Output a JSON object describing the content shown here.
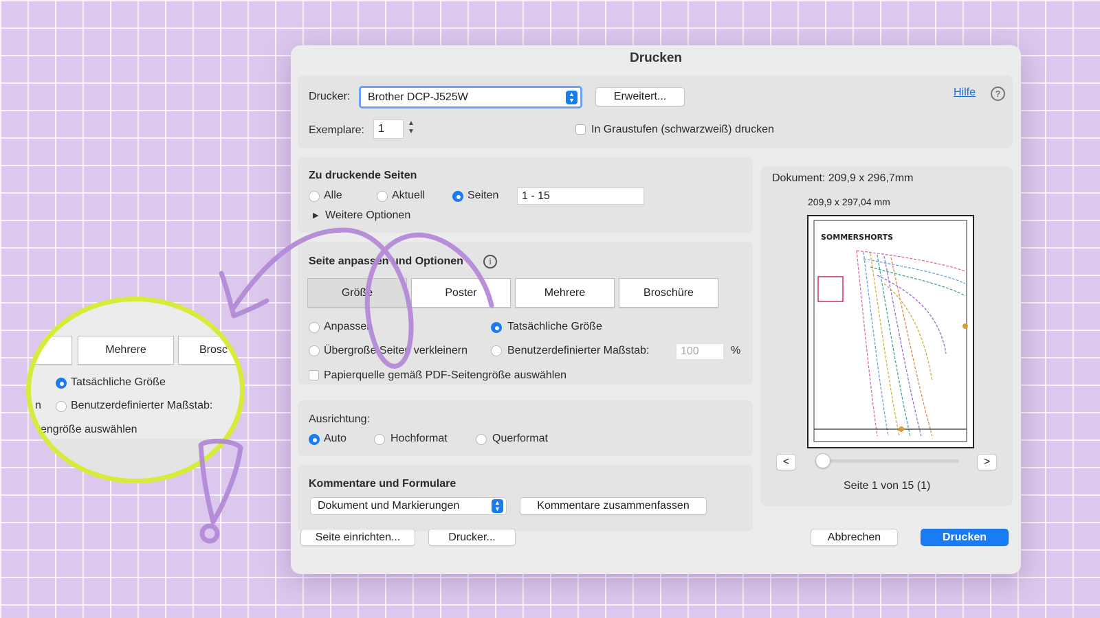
{
  "dialog": {
    "title": "Drucken",
    "printer_label": "Drucker:",
    "printer_value": "Brother DCP-J525W",
    "advanced_button": "Erweitert...",
    "help_link": "Hilfe",
    "copies_label": "Exemplare:",
    "copies_value": "1",
    "grayscale_label": "In Graustufen (schwarzweiß) drucken"
  },
  "pages": {
    "title": "Zu druckende Seiten",
    "all": "Alle",
    "current": "Aktuell",
    "pages": "Seiten",
    "range": "1 - 15",
    "more_options": "Weitere Optionen"
  },
  "fit": {
    "title": "Seite anpassen und Optionen",
    "tabs": [
      "Größe",
      "Poster",
      "Mehrere",
      "Broschüre"
    ],
    "fit": "Anpassen",
    "actual_size": "Tatsächliche Größe",
    "shrink": "Übergroße Seiten verkleinern",
    "custom_scale": "Benutzerdefinierter Maßstab:",
    "scale_value": "100",
    "percent": "%",
    "paper_source": "Papierquelle gemäß PDF-Seitengröße auswählen"
  },
  "orientation": {
    "title": "Ausrichtung:",
    "auto": "Auto",
    "portrait": "Hochformat",
    "landscape": "Querformat"
  },
  "comments": {
    "title": "Kommentare und Formulare",
    "select_value": "Dokument und Markierungen",
    "summarize_button": "Kommentare zusammenfassen"
  },
  "preview": {
    "document_size": "Dokument: 209,9 x 296,7mm",
    "page_size": "209,9 x 297,04 mm",
    "prev": "<",
    "next": ">",
    "page_info": "Seite 1 von 15 (1)",
    "slider_position": 0,
    "thumb_title": "SOMMERSHORTS"
  },
  "footer": {
    "page_setup": "Seite einrichten...",
    "printer": "Drucker...",
    "cancel": "Abbrechen",
    "print": "Drucken"
  },
  "magnifier": {
    "tab_multiple": "Mehrere",
    "tab_brochure_partial": "Brosc",
    "actual_size": "Tatsächliche Größe",
    "custom_scale": "Benutzerdefinierter Maßstab:",
    "paper_partial": "engröße auswählen",
    "left_fragment": "n"
  },
  "colors": {
    "accent": "#1a7cf4",
    "annotation_purple": "#b48ad8",
    "highlight_yellow": "#d7ec3a",
    "background_lavender": "#dcc8ec"
  }
}
